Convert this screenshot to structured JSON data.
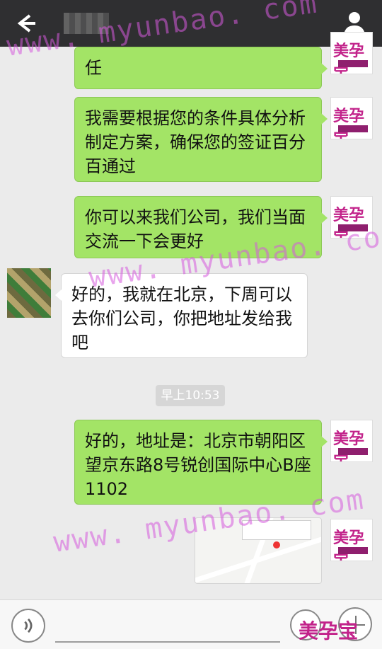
{
  "messages": [
    {
      "side": "right",
      "text": "任"
    },
    {
      "side": "right",
      "text": "我需要根据您的条件具体分析制定方案，确保您的签证百分百通过"
    },
    {
      "side": "right",
      "text": "你可以来我们公司，我们当面交流一下会更好"
    },
    {
      "side": "left",
      "text": "好的，我就在北京，下周可以去你们公司，你把地址发给我吧"
    },
    {
      "side": "right",
      "text": "好的，地址是：北京市朝阳区望京东路8号锐创国际中心B座1102"
    }
  ],
  "timestamp": "早上10:53",
  "watermark": "www. myunbao. com",
  "brand_logo": "美孕宝",
  "icons": [
    "back-icon",
    "contact-icon",
    "voice-icon",
    "emoji-icon",
    "plus-icon",
    "map-pin-icon"
  ],
  "colors": {
    "accent": "#a3e466",
    "brand": "#c2228a"
  }
}
